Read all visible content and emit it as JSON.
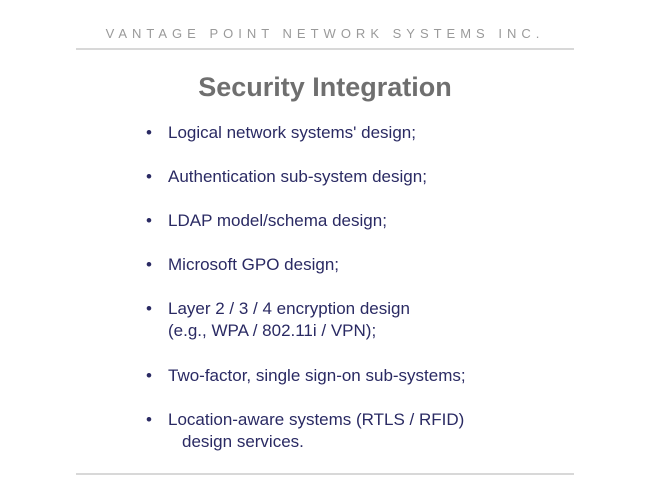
{
  "header": "VANTAGE POINT NETWORK SYSTEMS INC.",
  "title": "Security Integration",
  "bullets": [
    {
      "line1": "Logical network systems' design;"
    },
    {
      "line1": "Authentication sub-system design;"
    },
    {
      "line1": "LDAP model/schema design;"
    },
    {
      "line1": "Microsoft GPO design;"
    },
    {
      "line1": "Layer 2 / 3 / 4 encryption design",
      "line2": "(e.g., WPA / 802.11i / VPN);"
    },
    {
      "line1": "Two-factor, single sign-on sub-systems;"
    },
    {
      "line1": "Location-aware systems (RTLS / RFID)",
      "line2indent": "design services."
    }
  ]
}
